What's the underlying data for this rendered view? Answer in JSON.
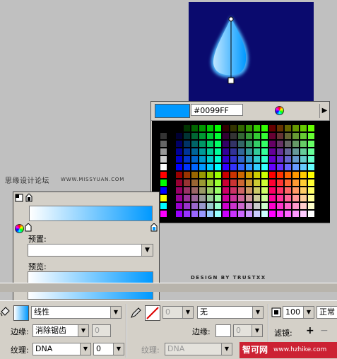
{
  "color_picker": {
    "hex": "#0099FF",
    "preview_color": "#0099ff"
  },
  "watermark": {
    "site_cn": "思缘设计论坛",
    "site_url": "WWW.MISSYUAN.COM"
  },
  "credit": "DESIGN BY TRUSTXX",
  "gradient_panel": {
    "preset_label": "预置:",
    "preview_label": "预览:"
  },
  "property_bar": {
    "fill_type": "线性",
    "edge_label": "边缘:",
    "edge_value": "消除锯齿",
    "edge_num": "0",
    "texture_label": "纹理:",
    "texture_value": "DNA",
    "texture_num": "0",
    "stroke_size": "0",
    "stroke_style": "无",
    "edge2_label": "边缘:",
    "edge2_num": "0",
    "texture2_label": "纹理:",
    "texture2_value": "DNA",
    "opacity": "100",
    "blend": "正常",
    "filter_label": "滤镜:",
    "filter_add": "+",
    "filter_remove": "−"
  },
  "overlay_badge": {
    "cn": "智可网",
    "url": "www.hzhike.com"
  }
}
